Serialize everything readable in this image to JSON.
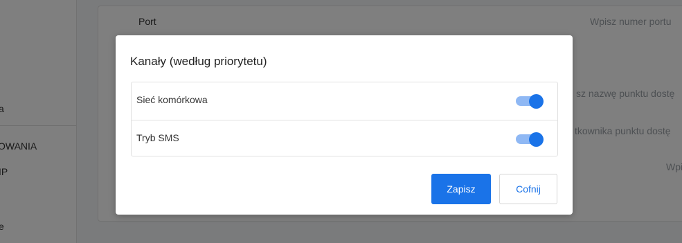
{
  "sidebar": {
    "items": [
      {
        "label": "a"
      },
      {
        "label": "OWANIA"
      },
      {
        "label": "IP"
      },
      {
        "label": "e"
      }
    ]
  },
  "form": {
    "port_label": "Port",
    "port_placeholder": "Wpisz numer portu",
    "apn_placeholder": "sz nazwę punktu dostę",
    "apn_user_placeholder": "tkownika punktu dostę",
    "host_placeholder": "Wpisz h"
  },
  "modal": {
    "title": "Kanały (według priorytetu)",
    "channels": [
      {
        "label": "Sieć komórkowa",
        "enabled": true
      },
      {
        "label": "Tryb SMS",
        "enabled": true
      }
    ],
    "save_label": "Zapisz",
    "cancel_label": "Cofnij"
  },
  "colors": {
    "accent": "#1a73e8",
    "toggle_track": "#8fb8f4"
  }
}
